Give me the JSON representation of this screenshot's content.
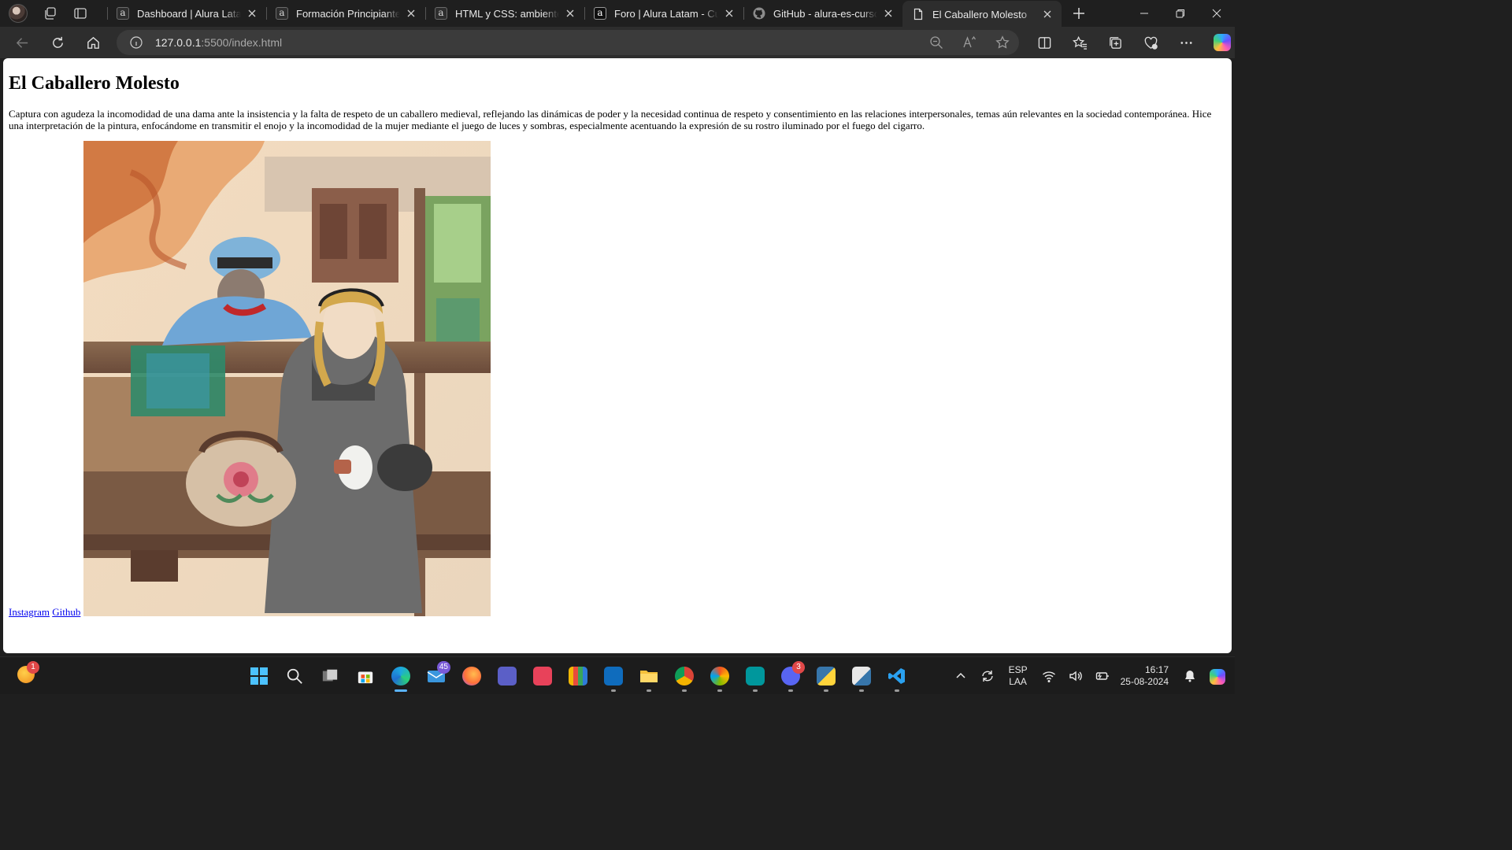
{
  "browser": {
    "tabs": [
      {
        "title": "Dashboard | Alura Latam",
        "favicon": "alura-icon"
      },
      {
        "title": "Formación Principiante en",
        "favicon": "alura-icon"
      },
      {
        "title": "HTML y CSS: ambientes de",
        "favicon": "alura-icon"
      },
      {
        "title": "Foro | Alura Latam - Curs",
        "favicon": "alura-icon"
      },
      {
        "title": "GitHub - alura-es-cursos/",
        "favicon": "github-icon"
      },
      {
        "title": "El Caballero Molesto",
        "favicon": "page-icon",
        "active": true
      }
    ],
    "address": {
      "host": "127.0.0.1",
      "rest": ":5500/index.html"
    }
  },
  "page": {
    "heading": "El Caballero Molesto",
    "description": "Captura con agudeza la incomodidad de una dama ante la insistencia y la falta de respeto de un caballero medieval, reflejando las dinámicas de poder y la necesidad continua de respeto y consentimiento en las relaciones interpersonales, temas aún relevantes en la sociedad contemporánea. Hice una interpretación de la pintura, enfocándome en transmitir el enojo y la incomodidad de la mujer mediante el juego de luces y sombras, especialmente acentuando la expresión de su rostro iluminado por el fuego del cigarro.",
    "links": {
      "instagram": "Instagram",
      "github": "Github"
    }
  },
  "taskbar": {
    "weather_badge": "1",
    "mail_badge": "45",
    "discord_badge": "3",
    "language": {
      "line1": "ESP",
      "line2": "LAA"
    },
    "clock": {
      "time": "16:17",
      "date": "25-08-2024"
    }
  },
  "colors": {
    "link": "#0000ee",
    "accent": "#5bb3ff"
  }
}
